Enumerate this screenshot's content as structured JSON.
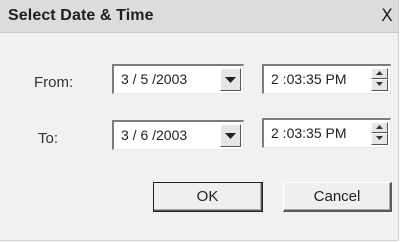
{
  "dialog": {
    "title": "Select Date & Time",
    "close_label": "X"
  },
  "from": {
    "label": "From:",
    "date": "3 / 5 /2003",
    "time": "2 :03:35 PM"
  },
  "to": {
    "label": "To:",
    "date": "3 / 6 /2003",
    "time": "2 :03:35 PM"
  },
  "buttons": {
    "ok": "OK",
    "cancel": "Cancel"
  },
  "icons": {
    "dropdown": "triangle-down-icon",
    "spin_up": "triangle-up-icon",
    "spin_down": "triangle-down-icon"
  }
}
